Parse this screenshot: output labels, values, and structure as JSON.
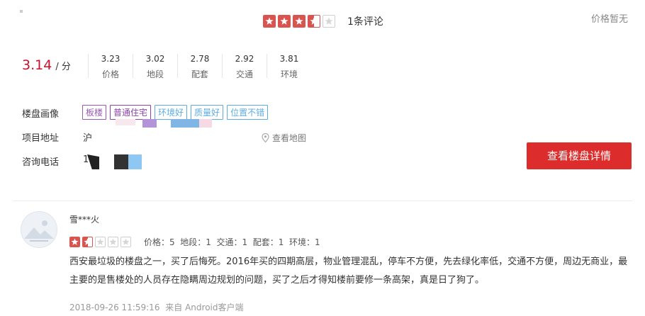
{
  "header": {
    "overall_rating_stars": 3.5,
    "review_count": "1条评论",
    "price": "价格暂无"
  },
  "score": {
    "value": "3.14",
    "unit": "/ 分",
    "sub_scores": [
      {
        "value": "3.23",
        "label": "价格"
      },
      {
        "value": "3.02",
        "label": "地段"
      },
      {
        "value": "2.78",
        "label": "配套"
      },
      {
        "value": "2.92",
        "label": "交通"
      },
      {
        "value": "3.81",
        "label": "环境"
      }
    ]
  },
  "info": {
    "portrait_label": "楼盘画像",
    "tags": [
      {
        "text": "板楼",
        "color": "#9b59b6"
      },
      {
        "text": "普通住宅",
        "color": "#8e44ad"
      },
      {
        "text": "环境好",
        "color": "#5dade2"
      },
      {
        "text": "质量好",
        "color": "#5dade2"
      },
      {
        "text": "位置不错",
        "color": "#5dade2"
      }
    ],
    "address_label": "项目地址",
    "address_value": "沪",
    "map_link": "查看地图",
    "phone_label": "咨询电话",
    "phone_value": "1",
    "detail_button": "查看楼盘详情"
  },
  "review": {
    "username": "雪***火",
    "rating_stars": 1.5,
    "sub_scores_text": "价格：5  地段：1  交通：1  配套：1  环境：1",
    "text": "西安最垃圾的楼盘之一，买了后悔死。2016年买的四期高层，物业管理混乱，停车不方便，先去绿化率低，交通不方便，周边无商业，最主要的是售楼处的人员存在隐瞒周边规划的问题，买了之后才得知楼前要修一条高架，真是日了狗了。",
    "timestamp": "2018-09-26 11:59:16",
    "source": "来自 Android客户端"
  },
  "colors": {
    "star_red": "#d9534f",
    "accent_red": "#c8102e",
    "button_red": "#dd2c2c"
  }
}
